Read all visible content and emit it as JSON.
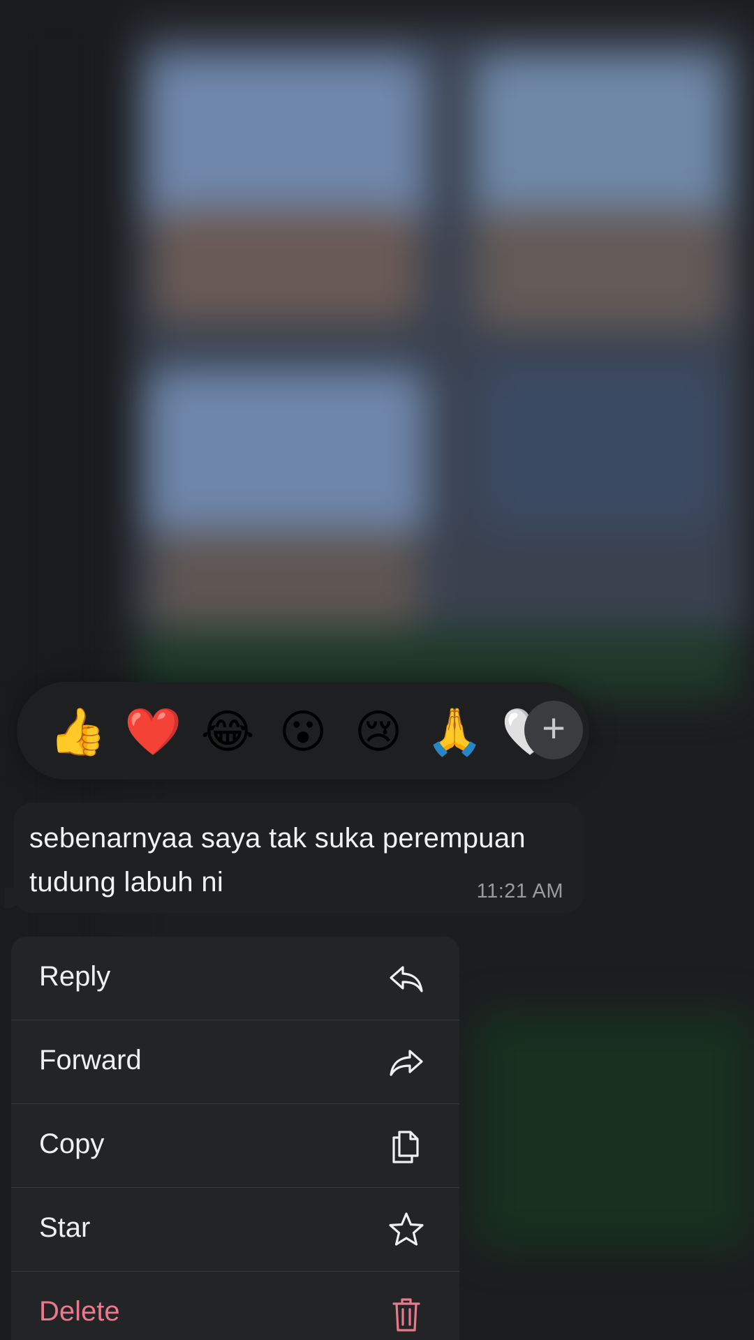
{
  "reactions": {
    "emojis": [
      {
        "name": "thumbs-up",
        "glyph": "👍"
      },
      {
        "name": "red-heart",
        "glyph": "❤️"
      },
      {
        "name": "face-with-tears-of-joy",
        "glyph": "😂"
      },
      {
        "name": "face-with-open-mouth",
        "glyph": "😮"
      },
      {
        "name": "crying-face",
        "glyph": "😢"
      },
      {
        "name": "folded-hands",
        "glyph": "🙏"
      },
      {
        "name": "white-heart",
        "glyph": "🤍"
      }
    ],
    "add_button_icon": "plus-icon",
    "add_button_glyph": "+"
  },
  "message": {
    "text": "sebenarnyaa saya tak suka perempuan tudung labuh ni",
    "time": "11:21 AM"
  },
  "menu": {
    "items": [
      {
        "label": "Reply",
        "icon": "reply-icon"
      },
      {
        "label": "Forward",
        "icon": "forward-icon"
      },
      {
        "label": "Copy",
        "icon": "copy-icon"
      },
      {
        "label": "Star",
        "icon": "star-icon"
      },
      {
        "label": "Delete",
        "icon": "trash-icon",
        "destructive": true
      }
    ]
  },
  "colors": {
    "destructive": "#e8798e",
    "menu_background": "#232426",
    "bubble_background": "#1f2022"
  }
}
